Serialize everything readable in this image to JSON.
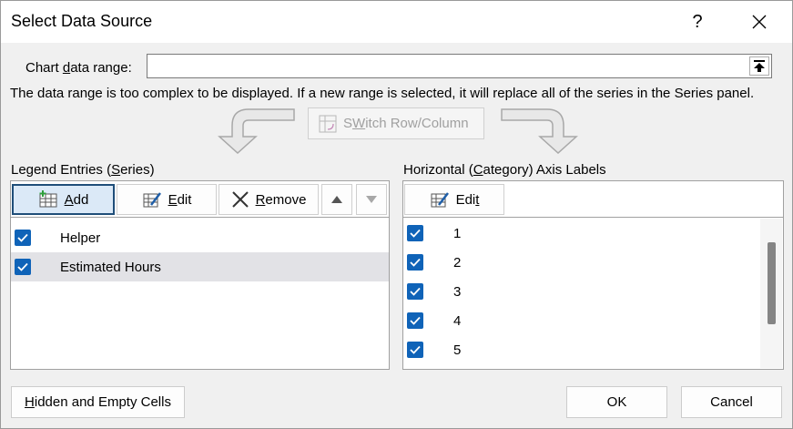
{
  "window": {
    "title": "Select Data Source",
    "help_label": "?"
  },
  "range": {
    "label_prefix": "Chart ",
    "label_u": "d",
    "label_suffix": "ata range:",
    "value": ""
  },
  "info_text": "The data range is too complex to be displayed. If a new range is selected, it will replace all of the series in the Series panel.",
  "switch_button": {
    "label_u": "W",
    "label_prefix": "S",
    "label_suffix": "itch Row/Column",
    "enabled": false
  },
  "legend": {
    "title_prefix": "Legend Entries (",
    "title_u": "S",
    "title_suffix": "eries)",
    "buttons": {
      "add_u": "A",
      "add_rest": "dd",
      "edit_u": "E",
      "edit_rest": "dit",
      "remove_u": "R",
      "remove_rest": "emove"
    },
    "items": [
      {
        "label": "Helper",
        "checked": true,
        "selected": false
      },
      {
        "label": "Estimated Hours",
        "checked": true,
        "selected": true
      }
    ]
  },
  "axis": {
    "title_prefix": "Horizontal (",
    "title_u": "C",
    "title_suffix": "ategory) Axis Labels",
    "edit_prefix": "Edi",
    "edit_u": "t",
    "items": [
      {
        "label": "1",
        "checked": true
      },
      {
        "label": "2",
        "checked": true
      },
      {
        "label": "3",
        "checked": true
      },
      {
        "label": "4",
        "checked": true
      },
      {
        "label": "5",
        "checked": true
      }
    ]
  },
  "footer": {
    "hidden_u": "H",
    "hidden_rest": "idden and Empty Cells",
    "ok": "OK",
    "cancel": "Cancel"
  },
  "colors": {
    "checkbox": "#0f63b8",
    "focus_border": "#1f4e79",
    "selected_row": "#e2e2e6"
  }
}
